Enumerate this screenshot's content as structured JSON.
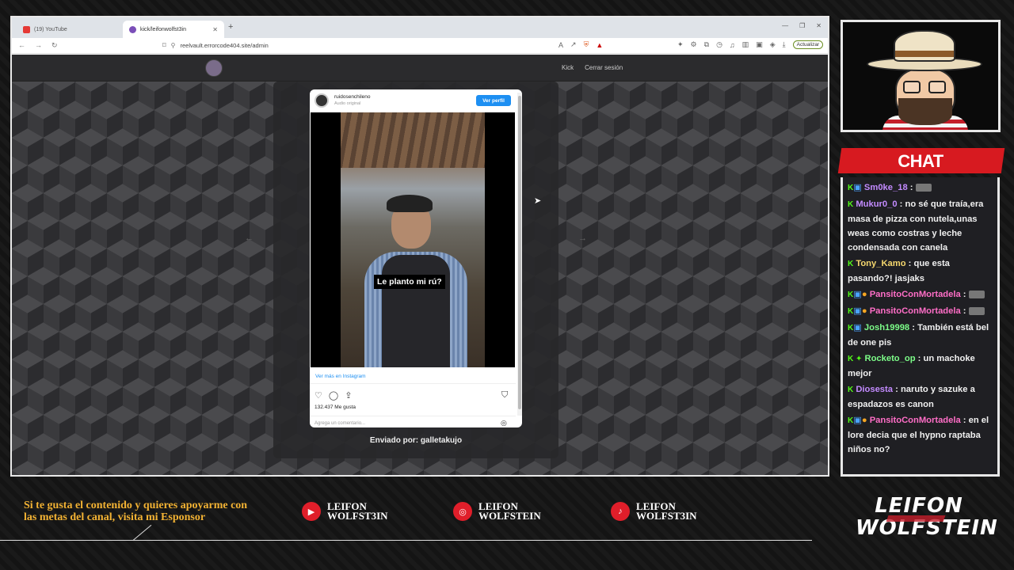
{
  "browser": {
    "tabs": [
      {
        "label": "(19) YouTube"
      },
      {
        "label": "kick/leifonwolfst3in"
      }
    ],
    "url": "reelvault.errorcode404.site/admin",
    "update_label": "Actualizar"
  },
  "page": {
    "links": [
      "Kick",
      "Cerrar sesión"
    ],
    "post": {
      "username": "ruidosenchileno",
      "audio": "Audio original",
      "follow_label": "Ver perfil",
      "caption": "Le planto mi rú?",
      "view_more": "Ver más en Instagram",
      "likes": "132.437 Me gusta",
      "comment_placeholder": "Agrega un comentario..."
    },
    "sent_by": "Enviado por: galletakujo"
  },
  "chat": {
    "title": "CHAT",
    "messages": [
      {
        "user": "Sm0ke_18",
        "text": ""
      },
      {
        "user": "Mukur0_0",
        "text": "no sé que traía,era masa de pizza con nutela,unas weas como costras y leche condensada con canela"
      },
      {
        "user": "Tony_Kamo",
        "text": "que esta pasando?! jasjaks"
      },
      {
        "user": "PansitoConMortadela",
        "text": ""
      },
      {
        "user": "PansitoConMortadela",
        "text": ""
      },
      {
        "user": "Josh19998",
        "text": "También está bel de one pis"
      },
      {
        "user": "Rocketo_op",
        "text": "un machoke mejor"
      },
      {
        "user": "Diosesta",
        "text": "naruto y sazuke a espadazos es canon"
      },
      {
        "user": "PansitoConMortadela",
        "text": "en el lore decia que el hypno raptaba niños no?"
      }
    ]
  },
  "footer": {
    "sponsor_text": "Si te gusta el contenido y quieres apoyarme con las metas del canal, visita mi Esponsor",
    "socials": [
      {
        "line1": "LEIFON",
        "line2": "WOLFST3IN",
        "icon": "youtube-icon"
      },
      {
        "line1": "LEIFON",
        "line2": "WOLFSTEIN",
        "icon": "instagram-icon"
      },
      {
        "line1": "LEIFON",
        "line2": "WOLFST3IN",
        "icon": "tiktok-icon"
      }
    ],
    "logo_line1": "LEIFON",
    "logo_line2": "WOLFSTEIN"
  }
}
